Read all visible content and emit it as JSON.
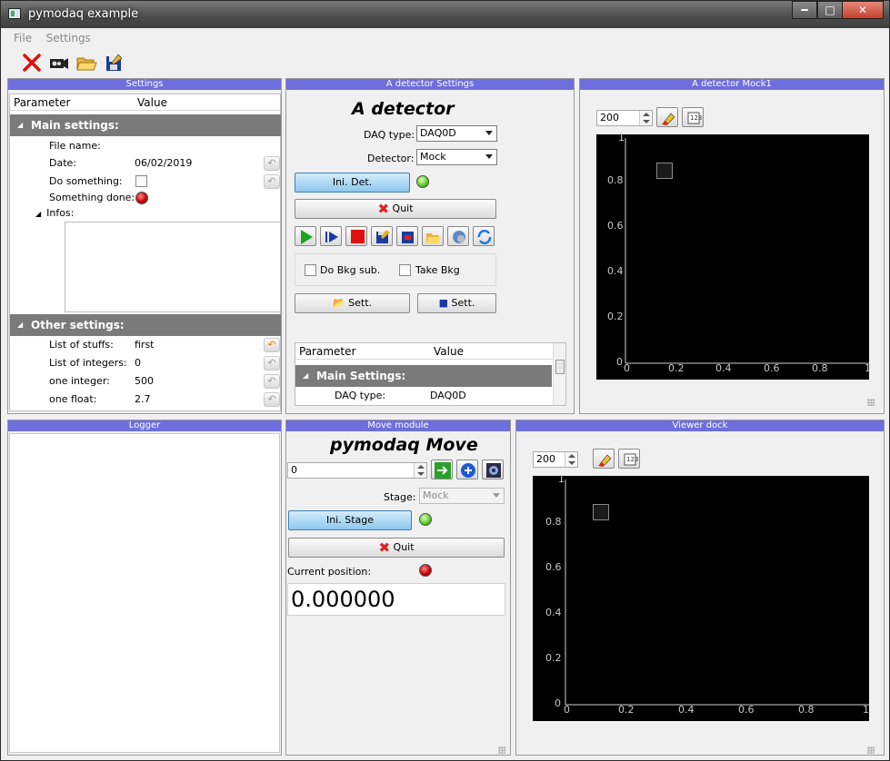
{
  "window": {
    "title": "pymodaq example",
    "minimize": "━",
    "maximize": "□",
    "close": "✕"
  },
  "menu": {
    "file": "File",
    "settings": "Settings"
  },
  "toolbar": {
    "icons": [
      "close-x-icon",
      "camera-icon",
      "folder-open-icon",
      "save-icon"
    ]
  },
  "settings_dock": {
    "title": "Settings",
    "col_parameter": "Parameter",
    "col_value": "Value",
    "main_group": "Main settings:",
    "file_name_label": "File name:",
    "date_label": "Date:",
    "date_value": "06/02/2019",
    "do_something_label": "Do something:",
    "something_done_label": "Something done:",
    "infos_label": "Infos:",
    "other_group": "Other settings:",
    "list_stuffs_label": "List of stuffs:",
    "list_stuffs_value": "first",
    "list_integers_label": "List of integers:",
    "list_integers_value": "0",
    "one_integer_label": "one integer:",
    "one_integer_value": "500",
    "one_float_label": "one float:",
    "one_float_value": "2.7"
  },
  "detector_settings": {
    "dock_title": "A detector  Settings",
    "heading": "A detector",
    "daq_type_label": "DAQ type:",
    "daq_type_value": "DAQ0D",
    "detector_label": "Detector:",
    "detector_value": "Mock",
    "ini_label": "Ini. Det.",
    "quit_label": "Quit",
    "do_bkg_label": "Do Bkg sub.",
    "take_bkg_label": "Take Bkg",
    "sett1_label": "Sett.",
    "sett2_label": "Sett.",
    "col_parameter": "Parameter",
    "col_value": "Value",
    "main_group": "Main Settings:",
    "daq_row_label": "DAQ type:",
    "daq_row_value": "DAQ0D"
  },
  "detector_viewer": {
    "dock_title": "A detector Mock1",
    "spin_value": "200",
    "y_ticks": [
      "1",
      "0.8",
      "0.6",
      "0.4",
      "0.2",
      "0"
    ],
    "x_ticks": [
      "0",
      "0.2",
      "0.4",
      "0.6",
      "0.8",
      "1"
    ]
  },
  "logger": {
    "dock_title": "Logger"
  },
  "move": {
    "dock_title": "Move module",
    "heading": "pymodaq Move",
    "position_input": "0",
    "stage_label": "Stage:",
    "stage_value": "Mock",
    "ini_label": "Ini. Stage",
    "quit_label": "Quit",
    "current_label": "Current position:",
    "current_value": "0.000000"
  },
  "viewer": {
    "dock_title": "Viewer dock",
    "spin_value": "200",
    "y_ticks": [
      "1",
      "0.8",
      "0.6",
      "0.4",
      "0.2",
      "0"
    ],
    "x_ticks": [
      "0",
      "0.2",
      "0.4",
      "0.6",
      "0.8",
      "1"
    ]
  }
}
